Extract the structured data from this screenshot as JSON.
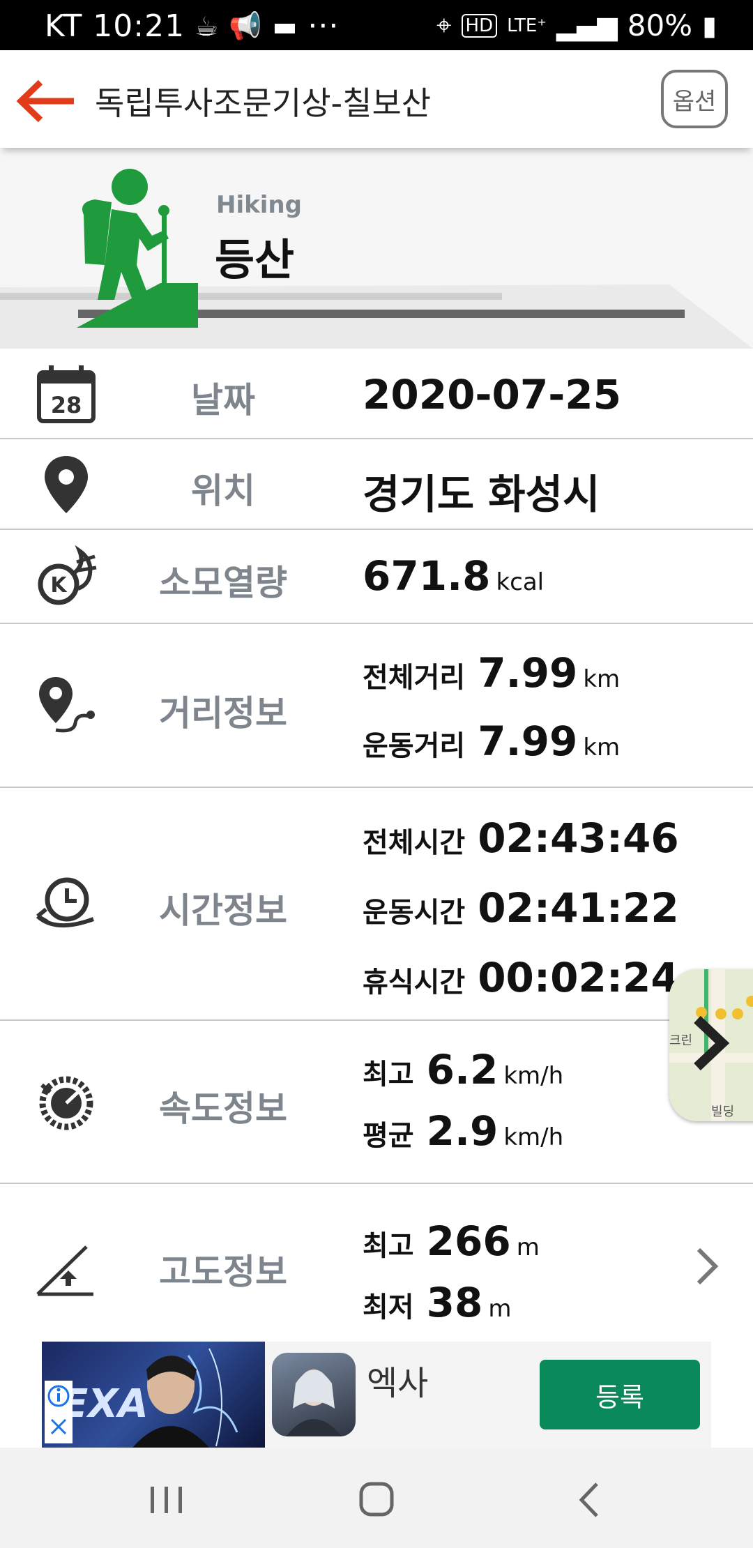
{
  "status_bar": {
    "carrier_time": "KT 10:21",
    "dots": "···",
    "battery": "80%",
    "icons": [
      "coffee-icon",
      "megaphone-icon",
      "chat-icon",
      "location-icon",
      "hd-icon",
      "lte-icon",
      "signal-icon",
      "battery-icon"
    ]
  },
  "app_bar": {
    "title": "독립투사조문기상-칠보산",
    "option_label": "옵션",
    "back_color": "#e03c1a"
  },
  "hero": {
    "subtitle": "Hiking",
    "title": "등산",
    "icon_color": "#1f9a3c"
  },
  "rows": {
    "date": {
      "label": "날짜",
      "value": "2020-07-25",
      "calendar_day": "28"
    },
    "location": {
      "label": "위치",
      "value": "경기도 화성시"
    },
    "calories": {
      "label": "소모열량",
      "value": "671.8",
      "unit": "kcal"
    },
    "distance": {
      "label": "거리정보",
      "total_label": "전체거리",
      "total_value": "7.99",
      "total_unit": "km",
      "exercise_label": "운동거리",
      "exercise_value": "7.99",
      "exercise_unit": "km"
    },
    "time": {
      "label": "시간정보",
      "total_label": "전체시간",
      "total_value": "02:43:46",
      "exercise_label": "운동시간",
      "exercise_value": "02:41:22",
      "rest_label": "휴식시간",
      "rest_value": "00:02:24"
    },
    "speed": {
      "label": "속도정보",
      "max_label": "최고",
      "max_value": "6.2",
      "max_unit": "km/h",
      "avg_label": "평균",
      "avg_value": "2.9",
      "avg_unit": "km/h"
    },
    "altitude": {
      "label": "고도정보",
      "max_label": "최고",
      "max_value": "266",
      "max_unit": "m",
      "min_label": "최저",
      "min_value": "38",
      "min_unit": "m"
    }
  },
  "map_thumb": {
    "text_top": "크린",
    "text_bottom": "빌딩"
  },
  "ad": {
    "app_name": "엑사",
    "register_label": "등록",
    "banner_text": "EXA",
    "button_color": "#0a8a5a"
  }
}
